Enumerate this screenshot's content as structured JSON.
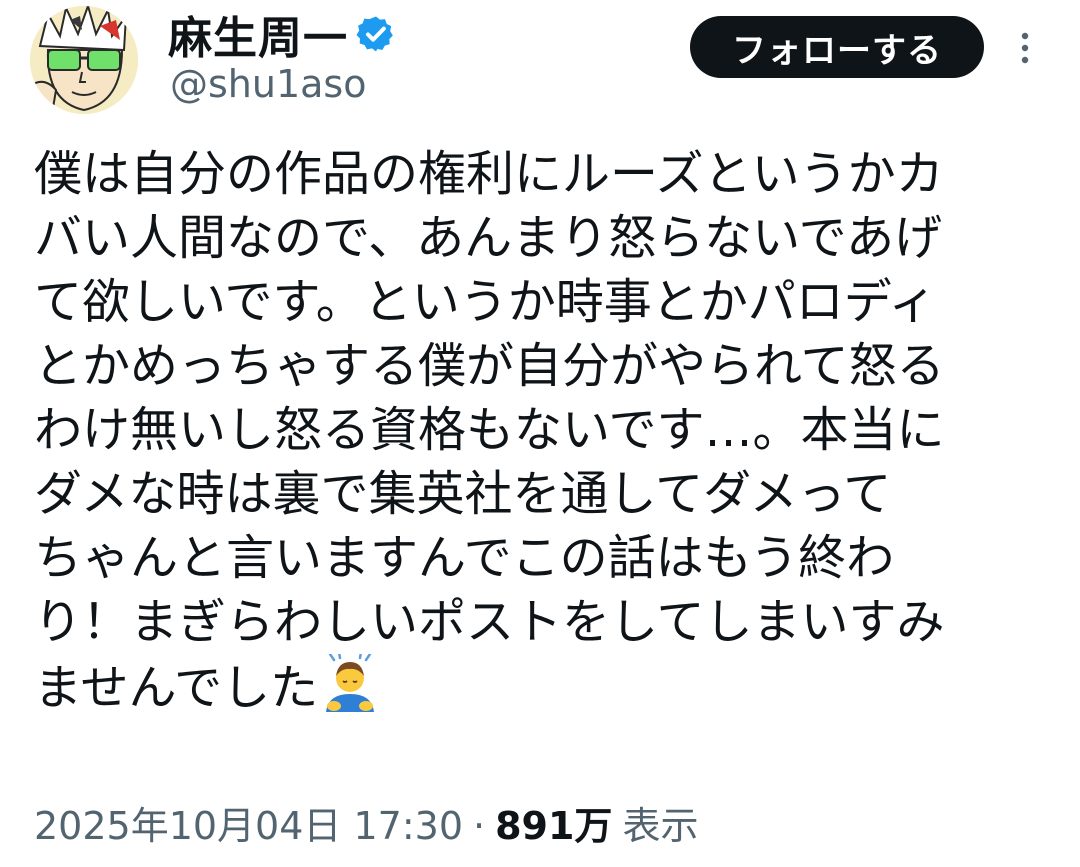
{
  "author": {
    "display_name": "麻生周一",
    "handle": "@shu1aso",
    "avatar_icon": "avatar-illustration-icon",
    "verified_icon": "verified-badge-icon",
    "verified_color": "#1d9bf0"
  },
  "actions": {
    "follow_label": "フォローする",
    "more_icon": "more-vertical-icon"
  },
  "post": {
    "lines": [
      "僕は自分の作品の権利にルーズというかカ",
      "バい人間なので、あんまり怒らないであげ",
      "て欲しいです。というか時事とかパロディ",
      "とかめっちゃする僕が自分がやられて怒る",
      "わけ無いし怒る資格もないです…。本当に",
      "ダメな時は裏で集英社を通してダメって",
      "ちゃんと言いますんでこの話はもう終わ",
      "り！まぎらわしいポストをしてしまいすみ",
      "ませんでした"
    ],
    "trailing_emoji": "person-bowing-emoji"
  },
  "meta": {
    "timestamp": "2025年10月04日 17:30",
    "separator": "·",
    "views_count": "891万",
    "views_label": "表示"
  },
  "colors": {
    "text_primary": "#0f1419",
    "text_secondary": "#536471",
    "follow_button_bg": "#0f1419"
  }
}
